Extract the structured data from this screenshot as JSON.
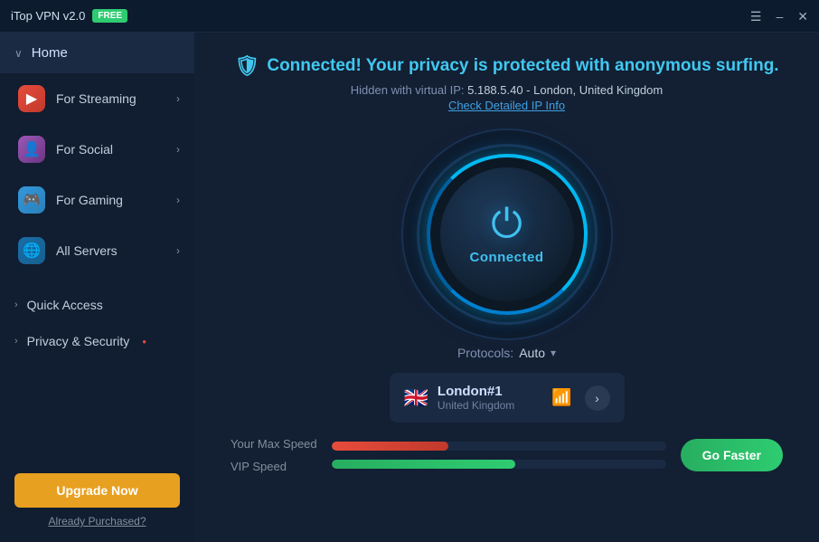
{
  "titleBar": {
    "appName": "iTop VPN v2.0",
    "badge": "FREE",
    "controls": {
      "menu": "☰",
      "minimize": "–",
      "close": "✕"
    }
  },
  "sidebar": {
    "homeLabel": "Home",
    "navItems": [
      {
        "id": "streaming",
        "label": "For Streaming",
        "iconClass": "icon-streaming",
        "iconEmoji": "▶"
      },
      {
        "id": "social",
        "label": "For Social",
        "iconClass": "icon-social",
        "iconEmoji": "👤"
      },
      {
        "id": "gaming",
        "label": "For Gaming",
        "iconClass": "icon-gaming",
        "iconEmoji": "🎮"
      },
      {
        "id": "servers",
        "label": "All Servers",
        "iconClass": "icon-servers",
        "iconEmoji": "🌐"
      }
    ],
    "sections": [
      {
        "id": "quick-access",
        "label": "Quick Access"
      },
      {
        "id": "privacy-security",
        "label": "Privacy & Security",
        "hasDot": true
      }
    ],
    "upgradeButton": "Upgrade Now",
    "alreadyPurchased": "Already Purchased?"
  },
  "content": {
    "statusBanner": "Connected! Your privacy is protected with anonymous surfing.",
    "ipLabel": "Hidden with virtual IP:",
    "ipValue": "5.188.5.40 - London, United Kingdom",
    "checkIpLink": "Check Detailed IP Info",
    "connectedLabel": "Connected",
    "protocolsLabel": "Protocols:",
    "protocolsValue": "Auto",
    "server": {
      "flag": "🇬🇧",
      "name": "London#1",
      "country": "United Kingdom"
    },
    "speedSection": {
      "maxSpeedLabel": "Your Max Speed",
      "vipSpeedLabel": "VIP Speed",
      "goFasterLabel": "Go Faster"
    }
  }
}
